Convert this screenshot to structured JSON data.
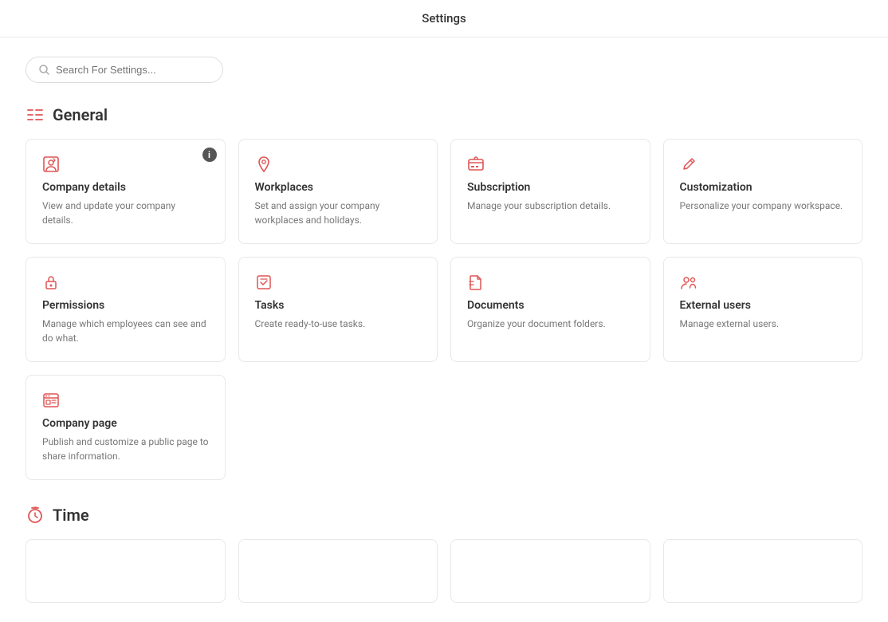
{
  "header": {
    "title": "Settings"
  },
  "search": {
    "placeholder": "Search For Settings..."
  },
  "general_section": {
    "title": "General",
    "cards": [
      {
        "id": "company-details",
        "title": "Company details",
        "desc": "View and update your company details.",
        "has_badge": true,
        "badge_text": "i"
      },
      {
        "id": "workplaces",
        "title": "Workplaces",
        "desc": "Set and assign your company workplaces and holidays.",
        "has_badge": false
      },
      {
        "id": "subscription",
        "title": "Subscription",
        "desc": "Manage your subscription details.",
        "has_badge": false
      },
      {
        "id": "customization",
        "title": "Customization",
        "desc": "Personalize your company workspace.",
        "has_badge": false
      },
      {
        "id": "permissions",
        "title": "Permissions",
        "desc": "Manage which employees can see and do what.",
        "has_badge": false
      },
      {
        "id": "tasks",
        "title": "Tasks",
        "desc": "Create ready-to-use tasks.",
        "has_badge": false
      },
      {
        "id": "documents",
        "title": "Documents",
        "desc": "Organize your document folders.",
        "has_badge": false
      },
      {
        "id": "external-users",
        "title": "External users",
        "desc": "Manage external users.",
        "has_badge": false
      }
    ],
    "single_row_cards": [
      {
        "id": "company-page",
        "title": "Company page",
        "desc": "Publish and customize a public page to share information.",
        "has_badge": false
      }
    ]
  },
  "time_section": {
    "title": "Time"
  }
}
